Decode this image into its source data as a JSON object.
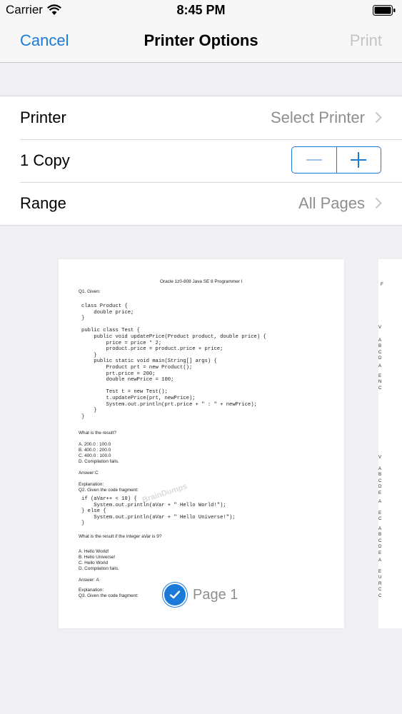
{
  "status_bar": {
    "carrier": "Carrier",
    "time": "8:45 PM",
    "icons": [
      "wifi-icon",
      "battery-icon"
    ]
  },
  "nav": {
    "cancel": "Cancel",
    "title": "Printer Options",
    "print": "Print"
  },
  "settings": {
    "printer_label": "Printer",
    "printer_value": "Select Printer",
    "copies_label": "1 Copy",
    "range_label": "Range",
    "range_value": "All Pages"
  },
  "colors": {
    "accent": "#1b7ad8",
    "disabled": "#c4c4c8",
    "secondary_text": "#8e8e93",
    "background": "#efeff4"
  },
  "preview": {
    "header": "Oracle 1z0-808 Java SE 8 Programmer I",
    "q1": "Q1. Given:",
    "code1": [
      "class Product {",
      "    double price;",
      "}",
      "",
      "public class Test {",
      "    public void updatePrice(Product product, double price) {",
      "        price = price * 2;",
      "        product.price = product.price + price;",
      "    }",
      "    public static void main(String[] args) {",
      "        Product prt = new Product();",
      "        prt.price = 200;",
      "        double newPrice = 100;",
      "",
      "        Test t = new Test();",
      "        t.updatePrice(prt, newPrice);",
      "        System.out.println(prt.price + \" : \" + newPrice);",
      "    }",
      "}"
    ],
    "q1_question": "What is the result?",
    "q1_options": [
      "A. 200.0 : 100.0",
      "B. 400.0 : 200.0",
      "C. 400.0 : 100.0",
      "D. Compilation fails."
    ],
    "q1_answer": "Answer:C",
    "explanation_label": "Explanation:",
    "q2": "Q2. Given the code fragment:",
    "code2": [
      "if (aVar++ < 10) {",
      "    System.out.println(aVar + \" Hello World!\");",
      "} else {",
      "    System.out.println(aVar + \" Hello Universe!\");",
      "}"
    ],
    "q2_question": "What is the result if the integer aVar is 9?",
    "q2_options": [
      "A. Hello World!",
      "B. Hello Universe!",
      "C. Hello World",
      "D. Compilation fails."
    ],
    "q2_answer": "Answer: A",
    "explanation_label_2": "Explanation:",
    "q3": "Q3. Given the code fragment:",
    "watermark": "BrainDumps",
    "page_label": "Page 1"
  }
}
